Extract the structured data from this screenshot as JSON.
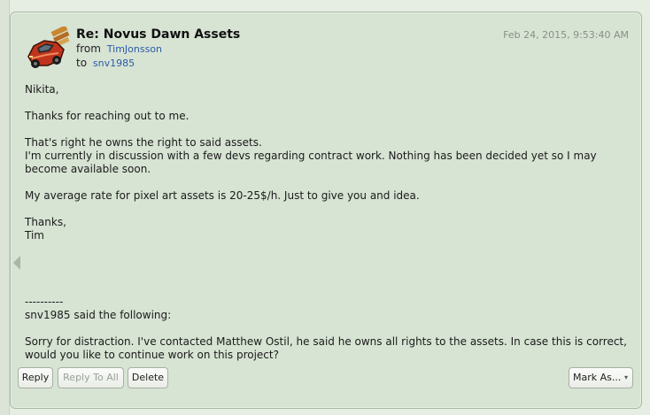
{
  "message": {
    "subject": "Re: Novus Dawn Assets",
    "from_label": "from",
    "from_user": "TimJonsson",
    "to_label": "to",
    "to_user": "snv1985",
    "timestamp": "Feb 24, 2015, 9:53:40 AM",
    "avatar_icon": "red-race-car-avatar",
    "body": {
      "greeting": "Nikita,",
      "p1": "Thanks for reaching out to me.",
      "p2_line1": "That's right he owns the right to said assets.",
      "p2_line2": "I'm currently in discussion with a few devs regarding contract work. Nothing has been decided yet so I may become available soon.",
      "p3": "My average rate for pixel art assets is 20-25$/h. Just to give you and idea.",
      "signoff": "Thanks,",
      "signature": "Tim"
    },
    "quoted": {
      "separator": "----------",
      "header": "snv1985 said the following:",
      "text": "Sorry for distraction. I've contacted Matthew Ostil, he said he owns all rights to the assets. In case this is correct, would you like to continue work on this project?"
    }
  },
  "actions": {
    "reply": "Reply",
    "reply_all": "Reply To All",
    "delete": "Delete",
    "mark_as": "Mark As...",
    "mark_as_arrow": "▾"
  },
  "colors": {
    "card_bg": "#d7e3d3",
    "link": "#2a5ca8",
    "timestamp": "#8a8f88"
  }
}
